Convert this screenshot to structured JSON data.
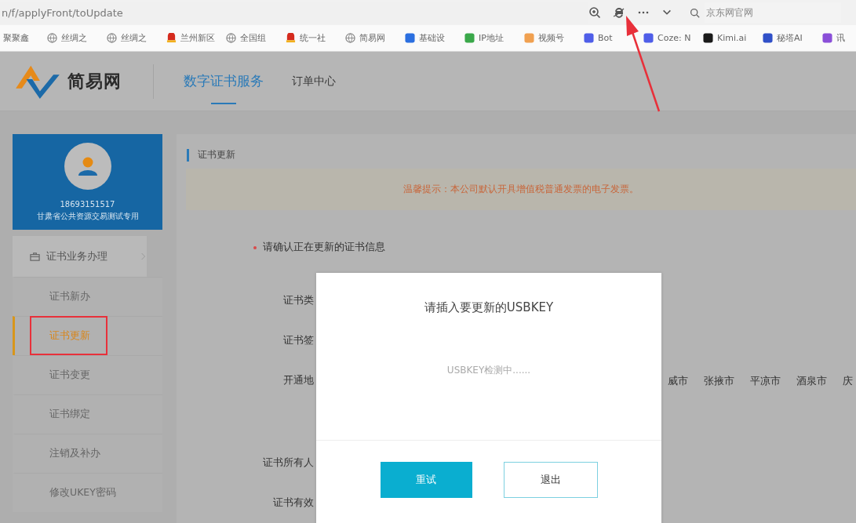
{
  "browser": {
    "address": "n/f/applyFront/toUpdate",
    "search_placeholder": "京东网官网",
    "bookmarks": [
      {
        "label": "聚聚鑫"
      },
      {
        "label": "丝绸之",
        "kind": "globe"
      },
      {
        "label": "丝绸之",
        "kind": "globe"
      },
      {
        "label": "兰州新区",
        "kind": "emblem"
      },
      {
        "label": "全国组",
        "kind": "globe"
      },
      {
        "label": "统一社",
        "kind": "emblem"
      },
      {
        "label": "简易网",
        "kind": "globe"
      },
      {
        "label": "基础设",
        "kind": "tile",
        "color": "#2b6fe0"
      },
      {
        "label": "IP地址",
        "kind": "tile",
        "color": "#3aa84a"
      },
      {
        "label": "视频号",
        "kind": "tile",
        "color": "#f0a050"
      },
      {
        "label": "Bot",
        "kind": "tile",
        "color": "#4f5ee8"
      },
      {
        "label": "Coze: N",
        "kind": "tile",
        "color": "#4f5ee8"
      },
      {
        "label": "Kimi.ai",
        "kind": "tile",
        "color": "#1a1a1a"
      },
      {
        "label": "秘塔AI",
        "kind": "tile",
        "color": "#3050c8"
      },
      {
        "label": "讯",
        "kind": "tile",
        "color": "#8a4fd8"
      }
    ]
  },
  "site": {
    "logo_text": "简易网",
    "nav": [
      {
        "label": "数字证书服务",
        "selected": true
      },
      {
        "label": "订单中心",
        "selected": false
      }
    ]
  },
  "profile": {
    "phone": "18693151517",
    "org": "甘肃省公共资源交易测试专用"
  },
  "sidebar": {
    "group": "证书业务办理",
    "items": [
      {
        "label": "证书新办",
        "selected": false
      },
      {
        "label": "证书更新",
        "selected": true
      },
      {
        "label": "证书变更",
        "selected": false
      },
      {
        "label": "证书绑定",
        "selected": false
      },
      {
        "label": "注销及补办",
        "selected": false
      },
      {
        "label": "修改UKEY密码",
        "selected": false
      }
    ]
  },
  "panel": {
    "title": "证书更新",
    "notice": "温馨提示：本公司默认开具增值税普通发票的电子发票。",
    "confirm": "请确认正在更新的证书信息",
    "fields": [
      {
        "label": "证书类"
      },
      {
        "label": "证书签"
      },
      {
        "label": "开通地",
        "regions": [
          "威市",
          "张掖市",
          "平凉市",
          "酒泉市",
          "庆"
        ]
      },
      {
        "label": "证书所有人"
      },
      {
        "label": "证书有效"
      }
    ]
  },
  "dialog": {
    "title": "请插入要更新的USBKEY",
    "message": "USBKEY检测中......",
    "buttons": [
      {
        "label": "重试",
        "kind": "primary"
      },
      {
        "label": "退出",
        "kind": "secondary"
      }
    ]
  }
}
